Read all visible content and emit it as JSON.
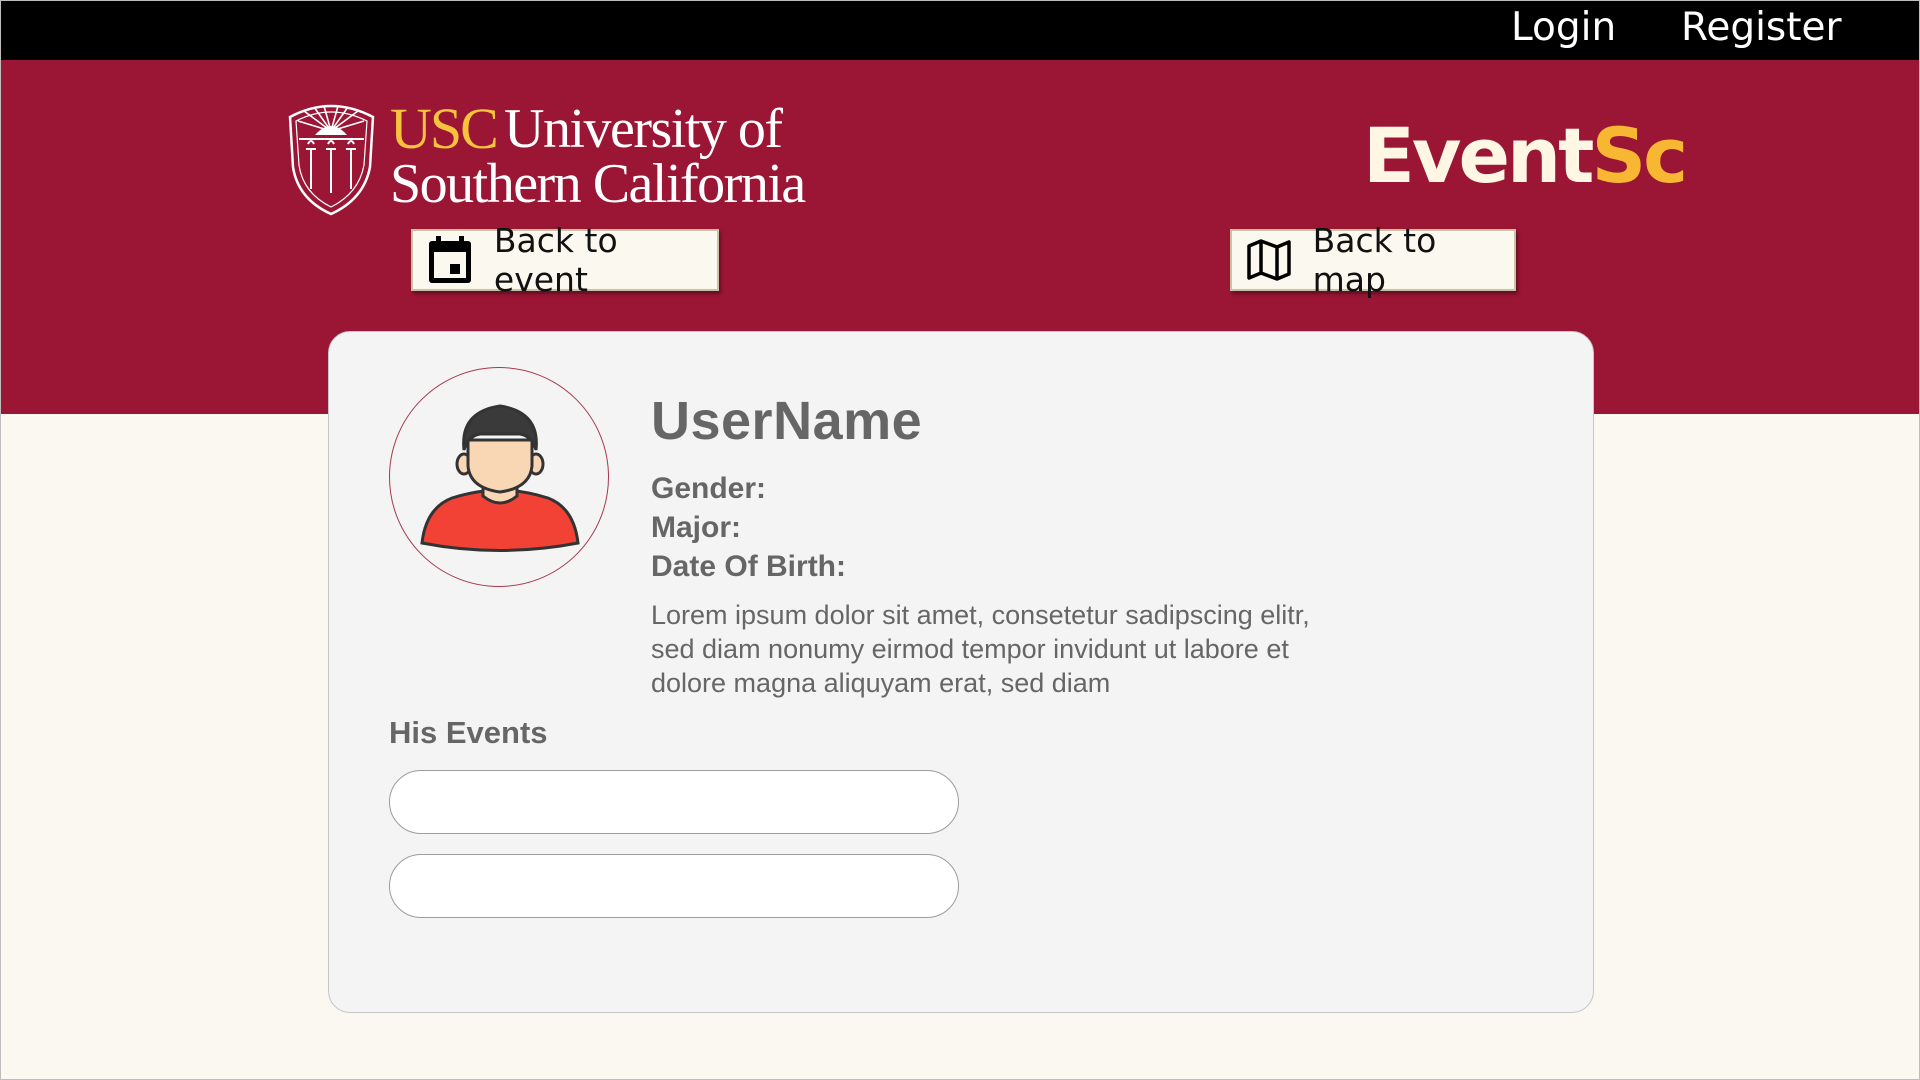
{
  "topbar": {
    "login_label": "Login",
    "register_label": "Register"
  },
  "header": {
    "logo": {
      "usc": "USC",
      "line1": "University of",
      "line2": "Southern California"
    },
    "brand": {
      "part1": "Event",
      "part2": "Sc"
    },
    "back_to_event_label": "Back to event",
    "back_to_map_label": "Back to map"
  },
  "profile": {
    "username": "UserName",
    "gender_label": "Gender:",
    "major_label": "Major:",
    "dob_label": "Date Of Birth:",
    "bio": "Lorem ipsum dolor sit amet, consetetur sadipscing elitr, sed diam nonumy eirmod tempor invidunt ut labore et dolore magna aliquyam erat, sed diam"
  },
  "events": {
    "title": "His Events",
    "items": [
      "",
      ""
    ]
  },
  "colors": {
    "banner": "#9b1535",
    "gold": "#f7b733",
    "topbar": "#000000",
    "page_bg": "#faf8f0"
  },
  "icons": {
    "event_button": "calendar-icon",
    "map_button": "map-icon",
    "avatar": "user-avatar-icon"
  }
}
